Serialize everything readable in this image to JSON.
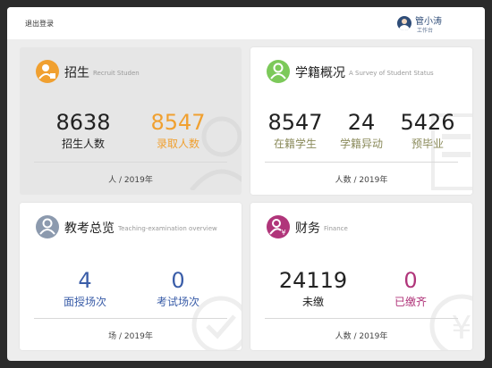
{
  "topbar": {
    "logout_label": "退出登录",
    "user_name": "管小涛",
    "user_role": "工作台"
  },
  "cards": {
    "enroll": {
      "title": "招生",
      "subtitle": "Recruit Studen",
      "stats": [
        {
          "value": "8638",
          "label": "招生人数",
          "color": "#222222"
        },
        {
          "value": "8547",
          "label": "录取人数",
          "color": "#f0a030"
        }
      ],
      "footer": "人 / 2019年",
      "icon_color": "#f0a030",
      "icon": "student-icon"
    },
    "status": {
      "title": "学籍概况",
      "subtitle": "A Survey of Student Status",
      "stats": [
        {
          "value": "8547",
          "label": "在籍学生"
        },
        {
          "value": "24",
          "label": "学籍异动"
        },
        {
          "value": "5426",
          "label": "预毕业"
        }
      ],
      "footer": "人数 / 2019年",
      "icon_color": "#7cc95a",
      "icon": "person-icon",
      "label_color": "#8a8a5a"
    },
    "exam": {
      "title": "教考总览",
      "subtitle": "Teaching-examination overview",
      "stats": [
        {
          "value": "4",
          "label": "面授场次"
        },
        {
          "value": "0",
          "label": "考试场次"
        }
      ],
      "footer": "场 / 2019年",
      "icon_color": "#8c9aae",
      "icon": "person-icon",
      "accent": "#3a5da8"
    },
    "finance": {
      "title": "财务",
      "subtitle": "Finance",
      "stats": [
        {
          "value": "24119",
          "label": "未缴",
          "color": "#222222"
        },
        {
          "value": "0",
          "label": "已缴齐",
          "color": "#b0357a"
        }
      ],
      "footer": "人数 / 2019年",
      "icon_color": "#b0357a",
      "icon": "person-yen-icon"
    }
  }
}
